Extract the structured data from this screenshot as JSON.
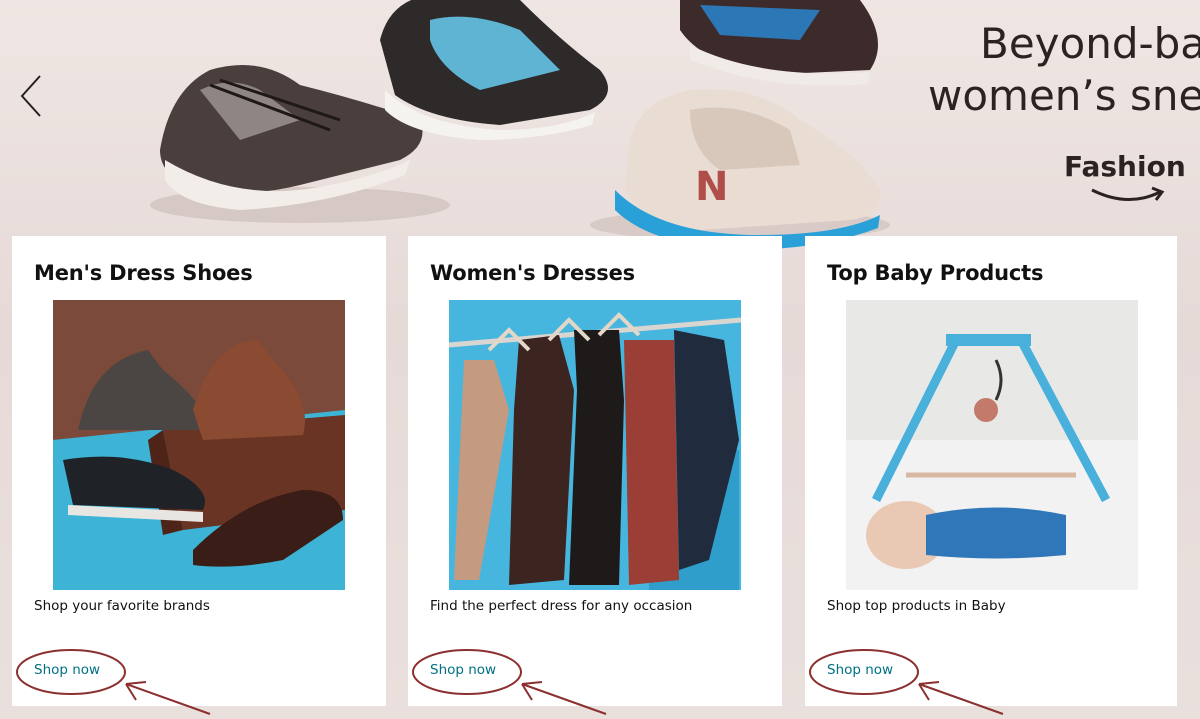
{
  "hero": {
    "headline_line1": "Beyond-ba",
    "headline_line2": "women’s sne",
    "brand": "Fashion"
  },
  "cards": [
    {
      "title": "Men's Dress Shoes",
      "subtitle": "Shop your favorite brands",
      "link": "Shop now"
    },
    {
      "title": "Women's Dresses",
      "subtitle": "Find the perfect dress for any occasion",
      "link": "Shop now"
    },
    {
      "title": "Top Baby Products",
      "subtitle": "Shop top products in Baby",
      "link": "Shop now"
    }
  ],
  "colors": {
    "link": "#007185",
    "annotation": "#8c2f2f",
    "text": "#111111",
    "accent_blue": "#3fb8d6"
  }
}
